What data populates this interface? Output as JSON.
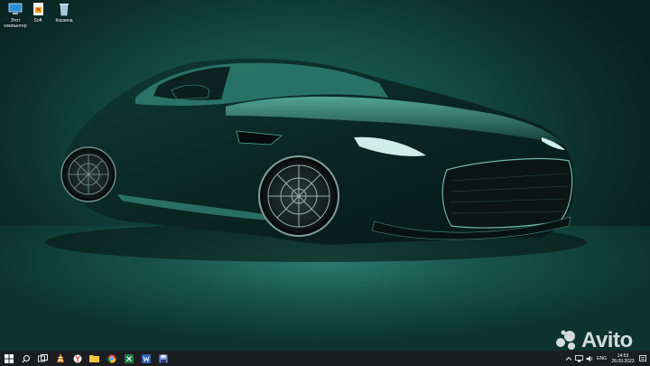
{
  "desktop": {
    "icons": [
      {
        "label": "Этот компьютер",
        "icon": "this-pc-icon"
      },
      {
        "label": "Soft",
        "icon": "folder-file-icon"
      },
      {
        "label": "Корзина",
        "icon": "recycle-bin-icon"
      }
    ],
    "wallpaper": "green sports car"
  },
  "watermark": {
    "text": "Avito"
  },
  "taskbar": {
    "buttons": [
      {
        "icon": "start-windows-icon"
      },
      {
        "icon": "search-icon"
      },
      {
        "icon": "task-view-icon"
      },
      {
        "icon": "vlc-icon"
      },
      {
        "icon": "yandex-browser-icon"
      },
      {
        "icon": "explorer-folder-icon"
      },
      {
        "icon": "chrome-icon"
      },
      {
        "icon": "excel-icon"
      },
      {
        "icon": "word-icon"
      },
      {
        "icon": "save-disk-icon"
      }
    ],
    "tray": {
      "lang": "ENG",
      "time": "14:53",
      "date": "26.09.2023"
    }
  },
  "colors": {
    "taskbar": "#1c1d21",
    "accent": "#2f8678"
  }
}
